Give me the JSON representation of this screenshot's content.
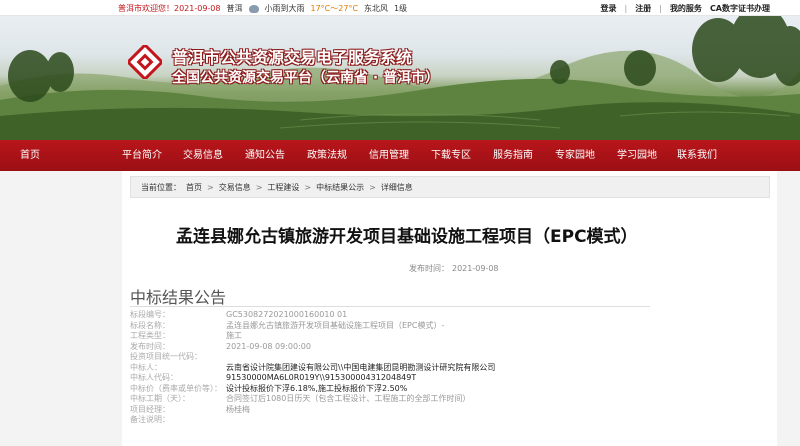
{
  "topbar": {
    "welcome": "普洱市欢迎您！2021-09-08",
    "city": "普洱",
    "weather": "小雨到大雨",
    "temp": "17°C～27°C",
    "wind": "东北风",
    "level": "1级",
    "login": "登录",
    "register": "注册",
    "my_services": "我的服务",
    "ca": "CA数字证书办理"
  },
  "banner": {
    "title": "普洱市公共资源交易电子服务系统",
    "subtitle": "全国公共资源交易平台（云南省 · 普洱市）"
  },
  "nav": {
    "items": [
      "首页",
      "平台简介",
      "交易信息",
      "通知公告",
      "政策法规",
      "信用管理",
      "下载专区",
      "服务指南",
      "专家园地",
      "学习园地",
      "联系我们"
    ]
  },
  "breadcrumb": {
    "prefix": "当前位置：",
    "items": [
      "首页",
      "交易信息",
      "工程建设",
      "中标结果公示",
      "详细信息"
    ]
  },
  "article": {
    "title": "孟连县娜允古镇旅游开发项目基础设施工程项目（EPC模式）",
    "publish_label": "发布时间：",
    "publish_time": "2021-09-08",
    "section": "中标结果公告"
  },
  "details": [
    {
      "k": "标段编号：",
      "v": "GC5308272021000160010 01",
      "strong": false
    },
    {
      "k": "标段名称：",
      "v": "孟连县娜允古镇旅游开发项目基础设施工程项目（EPC模式）-",
      "strong": false
    },
    {
      "k": "工程类型：",
      "v": "施工",
      "strong": false
    },
    {
      "k": "发布时间：",
      "v": "2021-09-08 09:00:00",
      "strong": false
    },
    {
      "k": "投资项目统一代码：",
      "v": "",
      "strong": false
    },
    {
      "k": "中标人：",
      "v": "云南省设计院集团建设有限公司\\\\中国电建集团昆明勘测设计研究院有限公司",
      "strong": true
    },
    {
      "k": "中标人代码：",
      "v": "91530000MA6L0R019Y\\\\91530000431204849T",
      "strong": true
    },
    {
      "k": "中标价（费率或单价等）：",
      "v": "设计投标报价下浮6.18%,施工投标报价下浮2.50%",
      "strong": true
    },
    {
      "k": "中标工期（天）：",
      "v": "合同签订后1080日历天（包含工程设计、工程施工的全部工作时间）",
      "strong": false
    },
    {
      "k": "项目经理：",
      "v": "杨桂梅",
      "strong": false
    },
    {
      "k": "备注说明：",
      "v": "",
      "strong": false
    }
  ]
}
